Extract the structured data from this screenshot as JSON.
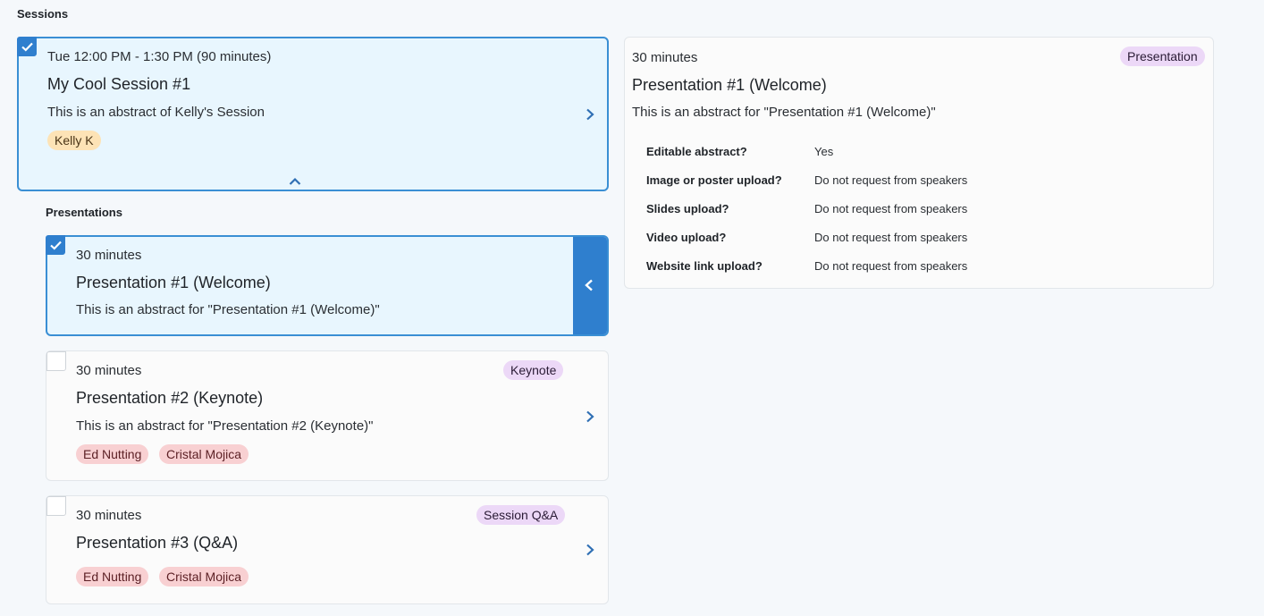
{
  "sections_heading": "Sessions",
  "presentations_heading": "Presentations",
  "session": {
    "time": "Tue 12:00 PM - 1:30 PM (90 minutes)",
    "title": "My Cool Session #1",
    "abstract": "This is an abstract of Kelly's Session",
    "speakers": [
      "Kelly K"
    ],
    "selected": true
  },
  "presentations": [
    {
      "duration": "30 minutes",
      "title": "Presentation #1 (Welcome)",
      "abstract": "This is an abstract for \"Presentation #1 (Welcome)\"",
      "type": "",
      "speakers": [],
      "selected": true
    },
    {
      "duration": "30 minutes",
      "title": "Presentation #2 (Keynote)",
      "abstract": "This is an abstract for \"Presentation #2 (Keynote)\"",
      "type": "Keynote",
      "speakers": [
        "Ed Nutting",
        "Cristal Mojica"
      ],
      "selected": false
    },
    {
      "duration": "30 minutes",
      "title": "Presentation #3 (Q&A)",
      "abstract": "",
      "type": "Session Q&A",
      "speakers": [
        "Ed Nutting",
        "Cristal Mojica"
      ],
      "selected": false
    }
  ],
  "detail": {
    "duration": "30 minutes",
    "type": "Presentation",
    "title": "Presentation #1 (Welcome)",
    "abstract": "This is an abstract for \"Presentation #1 (Welcome)\"",
    "fields": [
      {
        "label": "Editable abstract?",
        "value": "Yes"
      },
      {
        "label": "Image or poster upload?",
        "value": "Do not request from speakers"
      },
      {
        "label": "Slides upload?",
        "value": "Do not request from speakers"
      },
      {
        "label": "Video upload?",
        "value": "Do not request from speakers"
      },
      {
        "label": "Website link upload?",
        "value": "Do not request from speakers"
      }
    ]
  },
  "colors": {
    "accent": "#2f7fce",
    "selected_bg": "#e8f6fe",
    "speaker_orange": "#fde3b6",
    "speaker_red": "#f8d0d2",
    "type_tag": "#ecd8f7"
  },
  "icons": {
    "check": "check-icon",
    "expand": "chevron-right-icon",
    "collapse": "chevron-up-icon",
    "back": "chevron-left-icon"
  }
}
